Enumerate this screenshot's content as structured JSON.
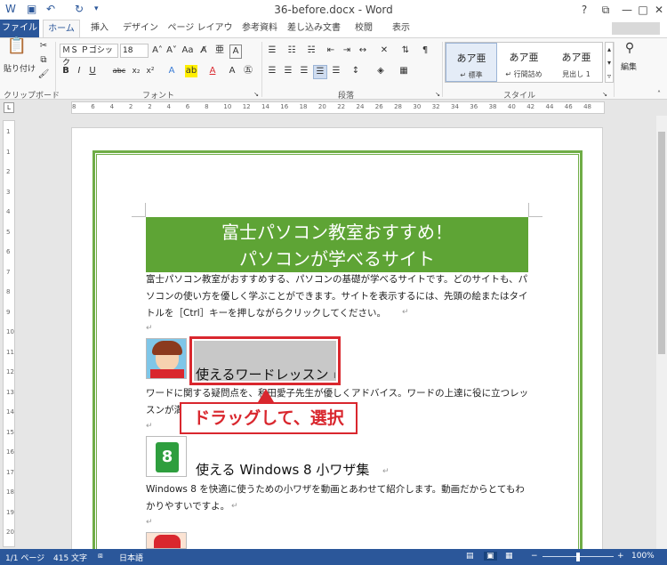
{
  "window": {
    "title": "36-before.docx - Word",
    "controls": {
      "help": "?",
      "restore": "⧉",
      "minimize": "—",
      "maximize": "□",
      "close": "✕"
    }
  },
  "quick_access": [
    "word-logo",
    "save-icon",
    "undo-icon",
    "redo-icon",
    "customize-icon"
  ],
  "tabs": [
    "ファイル",
    "ホーム",
    "挿入",
    "デザイン",
    "ページ レイアウト",
    "参考資料",
    "差し込み文書",
    "校閲",
    "表示"
  ],
  "active_tab": "ホーム",
  "ribbon": {
    "clipboard": {
      "paste_label": "貼り付け",
      "group_label": "クリップボード"
    },
    "font": {
      "font_name": "ＭＳ Ｐゴシック",
      "font_size": "18",
      "group_label": "フォント",
      "buttons": [
        "B",
        "I",
        "U",
        "abc",
        "x₂",
        "x²",
        "A"
      ]
    },
    "paragraph": {
      "group_label": "段落"
    },
    "styles": {
      "group_label": "スタイル",
      "items": [
        {
          "sample": "あア亜",
          "name": "↵ 標準"
        },
        {
          "sample": "あア亜",
          "name": "↵ 行間詰め"
        },
        {
          "sample": "あア亜",
          "name": "見出し 1"
        }
      ]
    },
    "editing": {
      "label": "編集"
    }
  },
  "ruler": {
    "numbers": [
      "8",
      "6",
      "4",
      "2",
      "2",
      "4",
      "6",
      "8",
      "10",
      "12",
      "14",
      "16",
      "18",
      "20",
      "22",
      "24",
      "26",
      "28",
      "30",
      "32",
      "34",
      "36",
      "38",
      "40",
      "42",
      "44",
      "46",
      "48"
    ]
  },
  "vertical_ruler": {
    "numbers": [
      "1",
      "1",
      "2",
      "3",
      "4",
      "5",
      "6",
      "7",
      "8",
      "9",
      "10",
      "11",
      "12",
      "13",
      "14",
      "15",
      "16",
      "17",
      "18",
      "19",
      "20"
    ]
  },
  "document": {
    "banner_line1": "富士パソコン教室おすすめ！",
    "banner_line2": "パソコンが学べるサイト",
    "intro_lines": [
      "富士パソコン教室がおすすめする、パソコンの基礎が学べるサイトです。どのサイトも、パ",
      "ソコンの使い方を優しく学ぶことができます。サイトを表示するには、先頭の絵またはタイ",
      "トルを［Ctrl］キーを押しながらクリックしてください。"
    ],
    "section1": {
      "title": "使えるワードレッスン",
      "lines": [
        "ワードに関する疑問点を、和田愛子先生が優しくアドバイス。ワードの上達に役に立つレッ",
        "スンが満"
      ]
    },
    "section2": {
      "title": "使える Windows 8 小ワザ集",
      "icon_text": "8",
      "lines": [
        "Windows 8 を快適に使うための小ワザを動画とあわせて紹介します。動画だからとてもわ",
        "かりやすいですよ。"
      ]
    }
  },
  "annotation": {
    "callout": "ドラッグして、選択"
  },
  "statusbar": {
    "page": "1/1 ページ",
    "words": "415 文字",
    "language": "日本語",
    "zoom": "100%",
    "minus": "−",
    "plus": "+"
  },
  "colors": {
    "accent": "#2b579a",
    "banner": "#5ea435",
    "page_border": "#70ad47",
    "highlight_red": "#d9272e",
    "selection": "#c8c8c8"
  }
}
